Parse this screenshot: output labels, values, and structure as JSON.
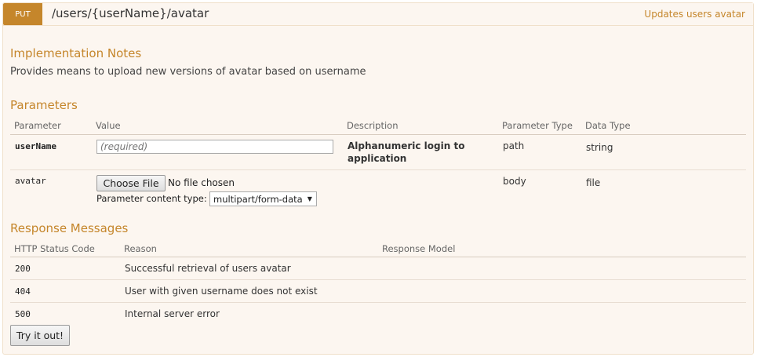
{
  "operation": {
    "method": "PUT",
    "path": "/users/{userName}/avatar",
    "summary": "Updates users avatar"
  },
  "implementation": {
    "heading": "Implementation Notes",
    "notes": "Provides means to upload new versions of avatar based on username"
  },
  "parameters": {
    "heading": "Parameters",
    "columns": [
      "Parameter",
      "Value",
      "Description",
      "Parameter Type",
      "Data Type"
    ],
    "rows": [
      {
        "name": "userName",
        "placeholder": "(required)",
        "description": "Alphanumeric login to application",
        "param_type": "path",
        "data_type": "string"
      },
      {
        "name": "avatar",
        "file_button": "Choose File",
        "file_status": "No file chosen",
        "content_type_label": "Parameter content type:",
        "content_type_value": "multipart/form-data",
        "description": "",
        "param_type": "body",
        "data_type": "file"
      }
    ]
  },
  "responses": {
    "heading": "Response Messages",
    "columns": [
      "HTTP Status Code",
      "Reason",
      "Response Model"
    ],
    "rows": [
      {
        "code": "200",
        "reason": "Successful retrieval of users avatar"
      },
      {
        "code": "404",
        "reason": "User with given username does not exist"
      },
      {
        "code": "500",
        "reason": "Internal server error"
      }
    ]
  },
  "try_button": "Try it out!"
}
